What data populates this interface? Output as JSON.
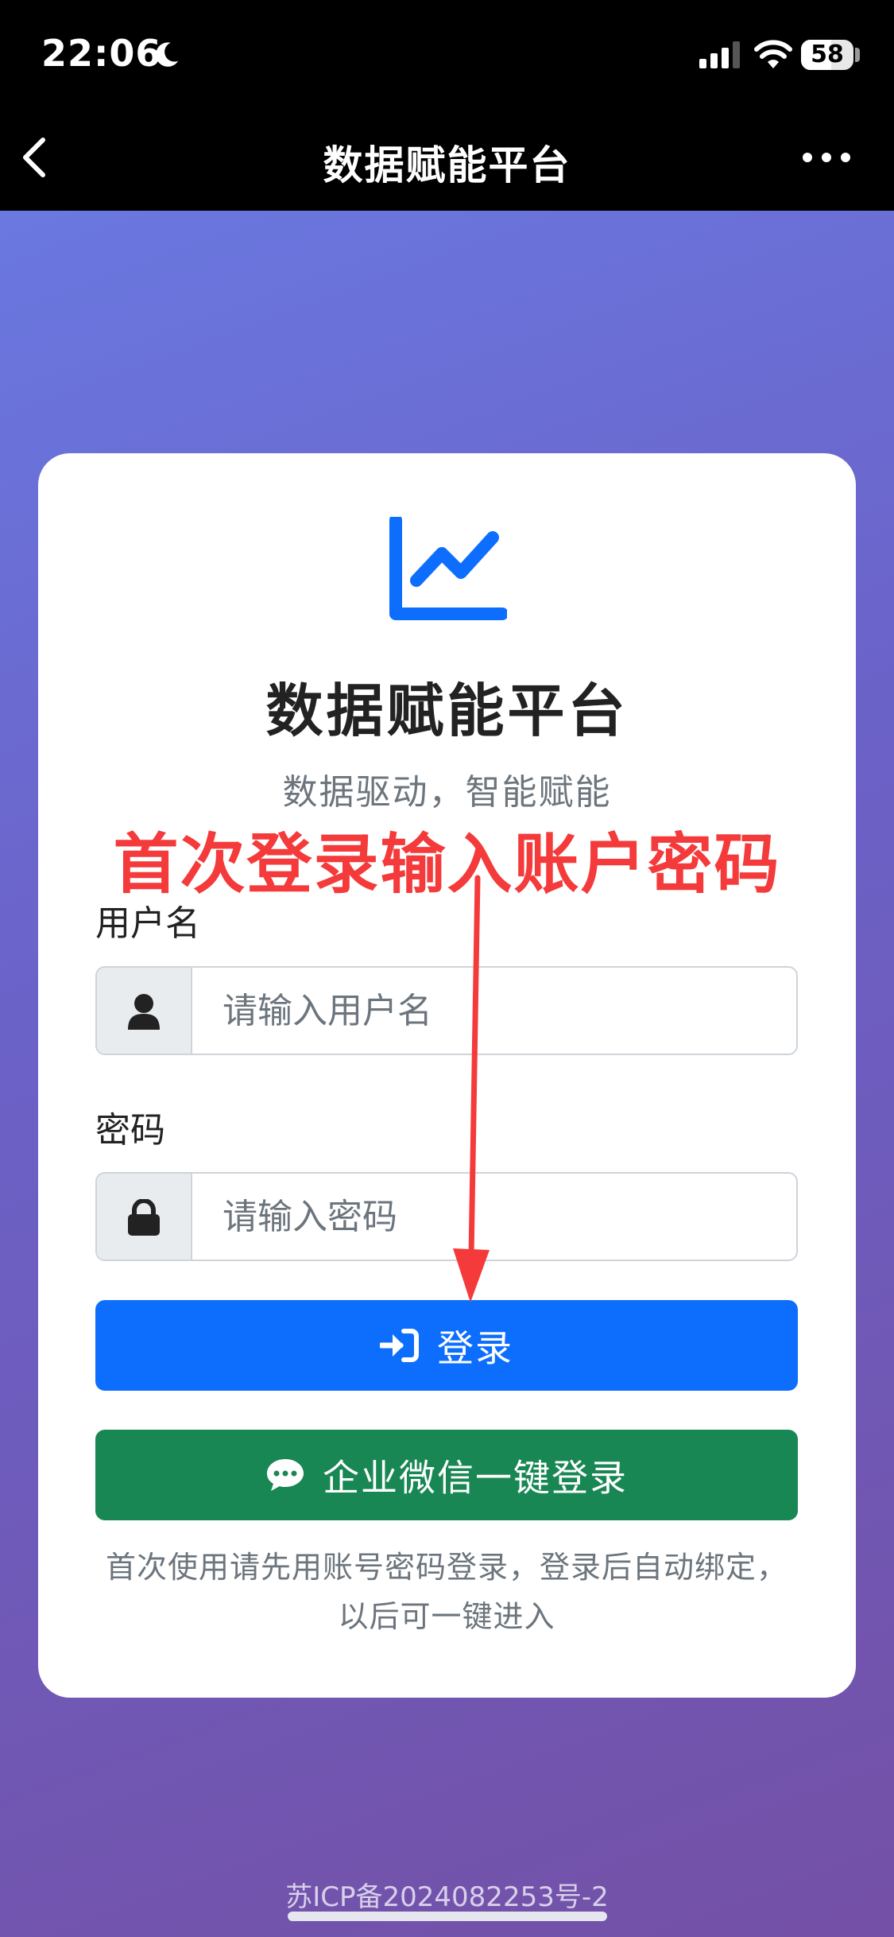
{
  "status_bar": {
    "time": "22:06",
    "battery": "58",
    "battery_level": 0.58
  },
  "nav": {
    "title": "数据赋能平台"
  },
  "card": {
    "title": "数据赋能平台",
    "subtitle": "数据驱动，智能赋能",
    "annotation": "首次登录输入账户密码",
    "username": {
      "label": "用户名",
      "placeholder": "请输入用户名"
    },
    "password": {
      "label": "密码",
      "placeholder": "请输入密码"
    },
    "login_button": "登录",
    "wecom_button": "企业微信一键登录",
    "help_text": "首次使用请先用账号密码登录，登录后自动绑定，以后可一键进入"
  },
  "footer": {
    "icp": "苏ICP备2024082253号-2"
  },
  "colors": {
    "primary": "#0d6efd",
    "success": "#198754",
    "annotation": "#f43a3a"
  },
  "icons": [
    "moon-icon",
    "signal-icon",
    "wifi-icon",
    "back-icon",
    "more-icon",
    "chart-line-icon",
    "user-icon",
    "lock-icon",
    "sign-in-icon",
    "chat-bubble-icon",
    "arrow-down-icon"
  ]
}
